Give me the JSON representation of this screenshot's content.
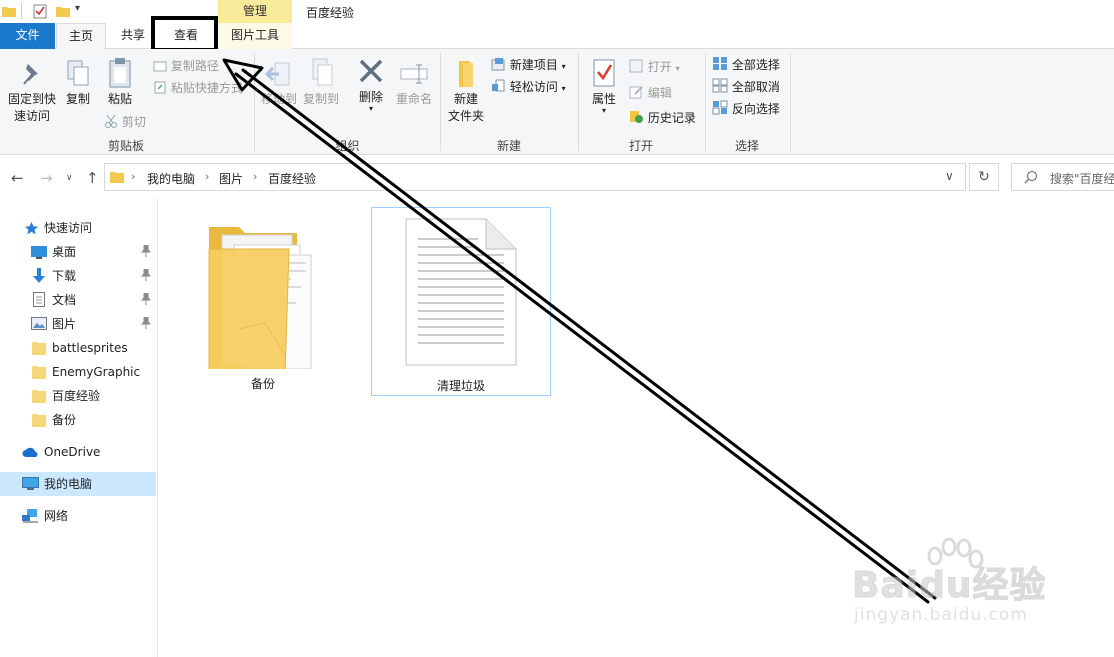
{
  "titlebar": {
    "manage_tab": "管理",
    "window_title": "百度经验"
  },
  "tabs": {
    "file": "文件",
    "home": "主页",
    "share": "共享",
    "view": "查看",
    "picture_tools": "图片工具"
  },
  "ribbon": {
    "clipboard": {
      "pin_label_1": "固定到快",
      "pin_label_2": "速访问",
      "copy": "复制",
      "paste": "粘贴",
      "copy_path": "复制路径",
      "paste_shortcut": "粘贴快捷方式",
      "cut": "剪切",
      "group": "剪贴板"
    },
    "organize": {
      "move_to": "移动到",
      "copy_to": "复制到",
      "delete": "删除",
      "rename": "重命名",
      "group": "组织"
    },
    "new": {
      "new_folder_1": "新建",
      "new_folder_2": "文件夹",
      "new_item": "新建项目",
      "easy_access": "轻松访问",
      "group": "新建"
    },
    "open": {
      "properties": "属性",
      "open": "打开",
      "edit": "编辑",
      "history": "历史记录",
      "group": "打开"
    },
    "select": {
      "select_all": "全部选择",
      "select_none": "全部取消",
      "invert": "反向选择",
      "group": "选择"
    }
  },
  "address": {
    "crumbs": [
      "我的电脑",
      "图片",
      "百度经验"
    ],
    "search_placeholder": "搜索\"百度经"
  },
  "sidebar": {
    "quick_access": "快速访问",
    "items": [
      {
        "label": "桌面",
        "icon": "desktop-icon",
        "pinned": true
      },
      {
        "label": "下载",
        "icon": "download-icon",
        "pinned": true
      },
      {
        "label": "文档",
        "icon": "document-icon",
        "pinned": true
      },
      {
        "label": "图片",
        "icon": "pictures-icon",
        "pinned": true
      },
      {
        "label": "battlesprites",
        "icon": "folder-icon",
        "pinned": false
      },
      {
        "label": "EnemyGraphic",
        "icon": "folder-icon",
        "pinned": false
      },
      {
        "label": "百度经验",
        "icon": "folder-icon",
        "pinned": false
      },
      {
        "label": "备份",
        "icon": "folder-icon",
        "pinned": false
      }
    ],
    "onedrive": "OneDrive",
    "this_pc": "我的电脑",
    "network": "网络"
  },
  "files": [
    {
      "name": "备份",
      "type": "folder"
    },
    {
      "name": "清理垃圾",
      "type": "text-file",
      "selected": true
    }
  ],
  "watermark": {
    "logo": "Baidu经验",
    "url": "jingyan.baidu.com"
  },
  "colors": {
    "accent": "#1979ca",
    "manage_band": "#f8eb9a",
    "selection": "#cce8ff"
  }
}
